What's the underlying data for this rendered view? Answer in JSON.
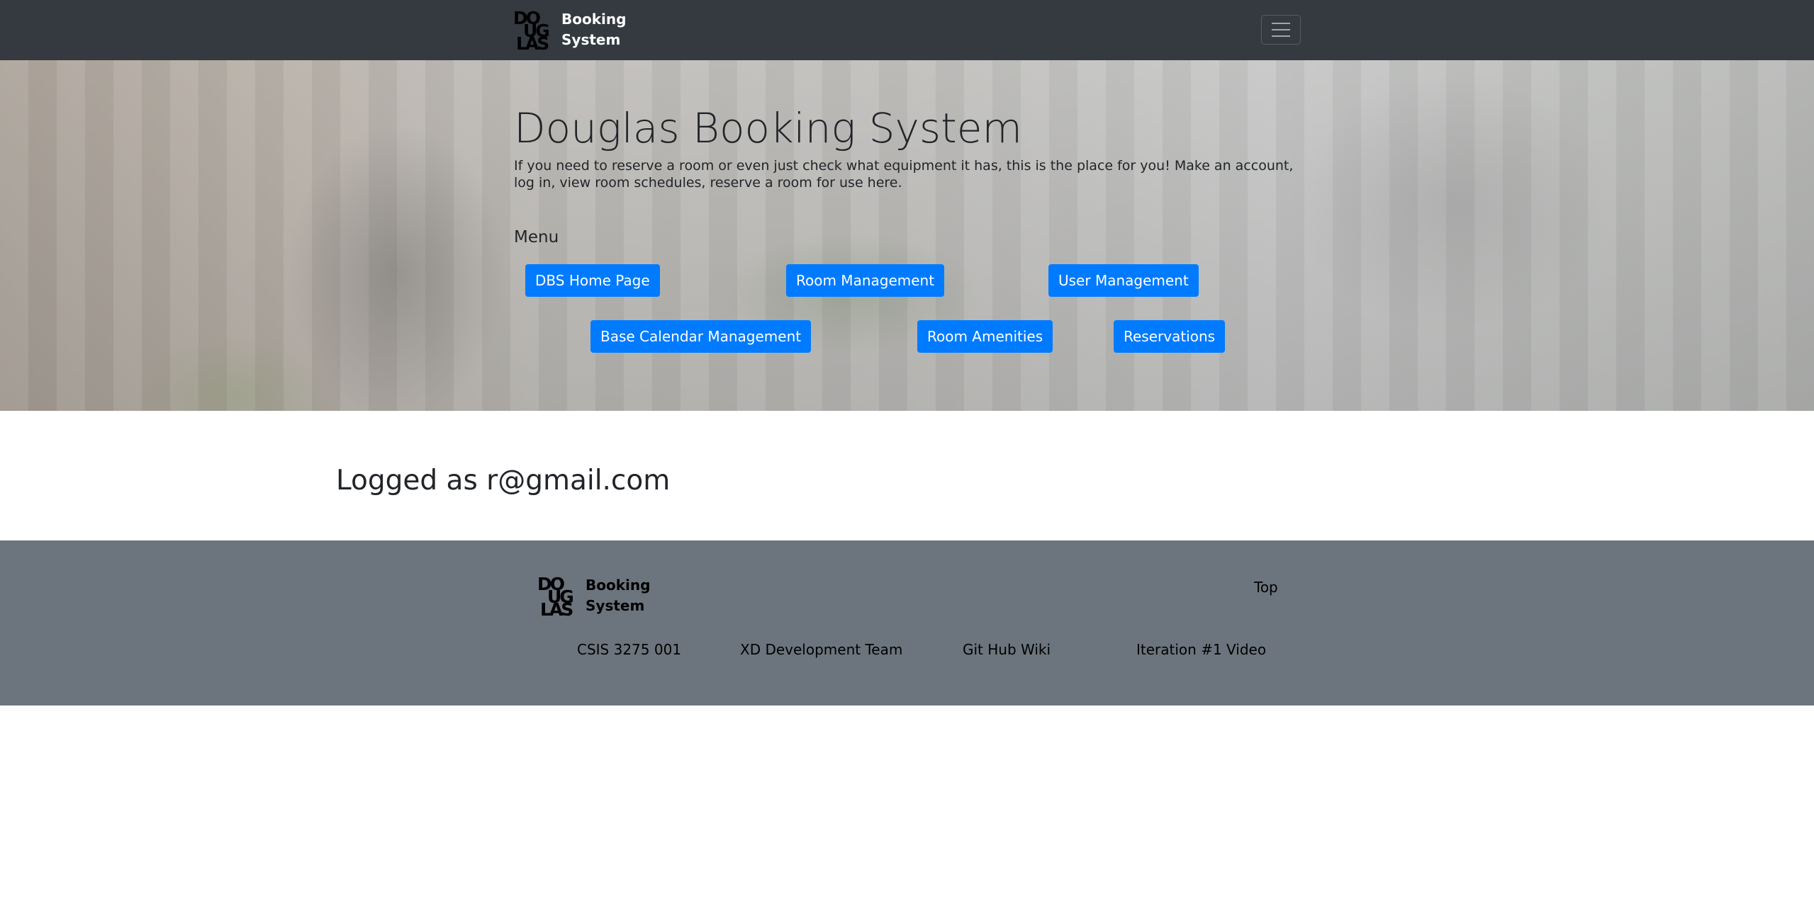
{
  "navbar": {
    "logo": {
      "line1": "DO",
      "line2": "UG",
      "line3": "LAS"
    },
    "brand_line1": "Booking",
    "brand_line2": "System",
    "toggler_icon": "hamburger-menu-icon"
  },
  "hero": {
    "title": "Douglas Booking System",
    "lead": "If you need to reserve a room or even just check what equipment it has, this is the place for you! Make an account, log in, view room schedules, reserve a room for use here.",
    "menu_heading": "Menu",
    "buttons": [
      "DBS Home Page",
      "Room Management",
      "User Management",
      "Base Calendar Management",
      "Room Amenities",
      "Reservations"
    ]
  },
  "session": {
    "logged_as": "Logged as r@gmail.com"
  },
  "footer": {
    "logo": {
      "line1": "DO",
      "line2": "UG",
      "line3": "LAS"
    },
    "brand_line1": "Booking",
    "brand_line2": "System",
    "top_link": "Top",
    "links": [
      "CSIS 3275 001",
      "XD Development Team",
      "Git Hub Wiki",
      "Iteration #1 Video"
    ]
  },
  "colors": {
    "navbar_bg": "#343a40",
    "primary_button": "#007bff",
    "footer_bg": "#6c757d"
  }
}
